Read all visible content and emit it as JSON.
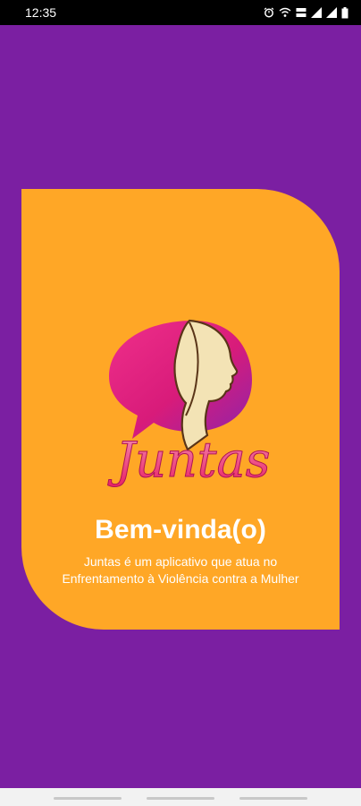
{
  "status_bar": {
    "time": "12:35",
    "icons": [
      "alarm-icon",
      "wifi-icon",
      "volte-icon",
      "signal-icon",
      "signal-icon",
      "battery-icon"
    ]
  },
  "splash": {
    "logo_text": "Juntas",
    "title": "Bem-vinda(o)",
    "description": "Juntas é um aplicativo que atua no Enfrentamento à Violência contra a Mulher"
  },
  "colors": {
    "background": "#7b1fa2",
    "card": "#ffa726",
    "text": "#ffffff",
    "logo_pink": "#e91e8c",
    "logo_cream": "#f3e3b5"
  },
  "nav_bar": {
    "buttons": [
      "recent-apps",
      "home",
      "back"
    ]
  }
}
